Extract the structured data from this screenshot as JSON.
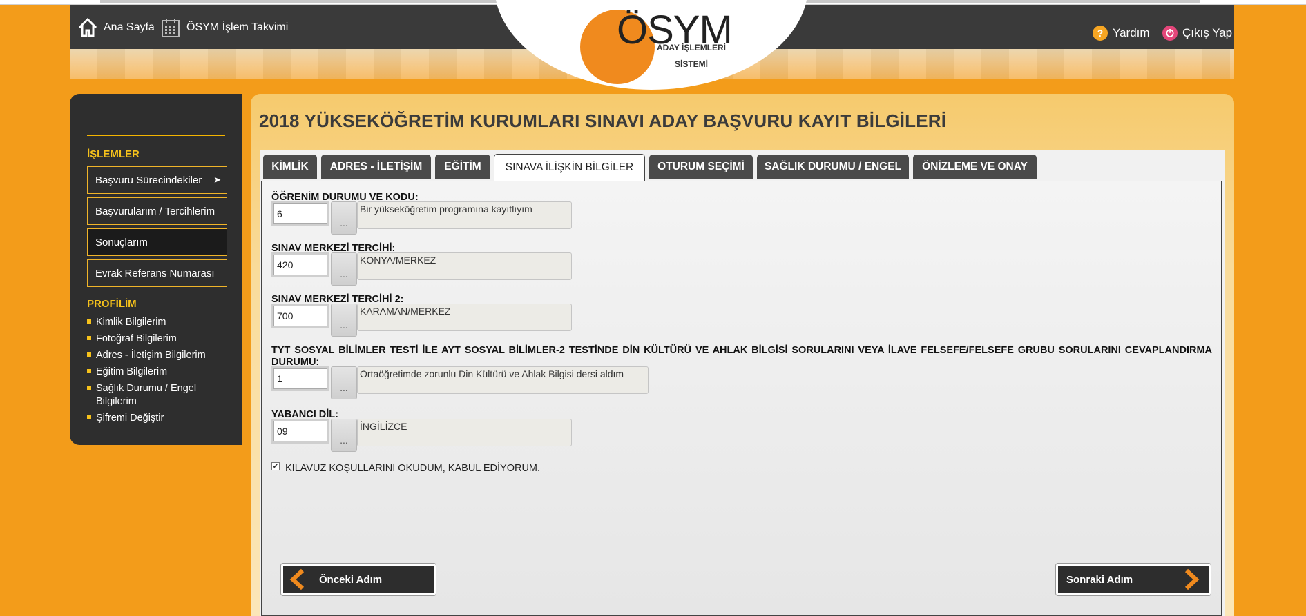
{
  "header": {
    "home_label": "Ana Sayfa",
    "calendar_label": "ÖSYM İşlem Takvimi",
    "help_label": "Yardım",
    "logout_label": "Çıkış Yap",
    "logo_text": "ÖSYM",
    "logo_sub1": "ADAY İŞLEMLERİ",
    "logo_sub2": "SİSTEMİ"
  },
  "sidebar": {
    "section_operations": "İŞLEMLER",
    "operations": [
      {
        "label": "Başvuru Sürecindekiler"
      },
      {
        "label": "Başvurularım / Tercihlerim"
      },
      {
        "label": "Sonuçlarım"
      },
      {
        "label": "Evrak Referans Numarası"
      }
    ],
    "section_profile": "PROFİLİM",
    "profile_items": [
      {
        "label": "Kimlik Bilgilerim"
      },
      {
        "label": "Fotoğraf Bilgilerim"
      },
      {
        "label": "Adres - İletişim Bilgilerim"
      },
      {
        "label": "Eğitim Bilgilerim"
      },
      {
        "label": "Sağlık Durumu / Engel Bilgilerim"
      },
      {
        "label": "Şifremi Değiştir"
      }
    ]
  },
  "main": {
    "title": "2018 YÜKSEKÖĞRETİM KURUMLARI SINAVI ADAY BAŞVURU KAYIT BİLGİLERİ",
    "tabs": [
      {
        "label": "KİMLİK"
      },
      {
        "label": "ADRES - İLETİŞİM"
      },
      {
        "label": "EĞİTİM"
      },
      {
        "label": "SINAVA İLİŞKİN BİLGİLER"
      },
      {
        "label": "OTURUM SEÇİMİ"
      },
      {
        "label": "SAĞLIK DURUMU / ENGEL"
      },
      {
        "label": "ÖNİZLEME VE ONAY"
      }
    ],
    "active_tab": "SINAVA İLİŞKİN BİLGİLER",
    "fields": [
      {
        "label": "ÖĞRENİM DURUMU VE KODU:",
        "code": "6",
        "description": "Bir yükseköğretim programına kayıtlıyım"
      },
      {
        "label": "SINAV MERKEZİ TERCİHİ:",
        "code": "420",
        "description": "KONYA/MERKEZ"
      },
      {
        "label": "SINAV MERKEZİ TERCİHİ 2:",
        "code": "700",
        "description": "KARAMAN/MERKEZ"
      },
      {
        "label": "TYT SOSYAL BİLİMLER TESTİ İLE AYT SOSYAL BİLİMLER-2 TESTİNDE DİN KÜLTÜRÜ VE AHLAK BİLGİSİ SORULARINI VEYA İLAVE FELSEFE/FELSEFE GRUBU SORULARINI CEVAPLANDIRMA DURUMU:",
        "code": "1",
        "description": "Ortaöğretimde zorunlu Din Kültürü ve Ahlak Bilgisi dersi aldım"
      },
      {
        "label": "YABANCI DİL:",
        "code": "09",
        "description": "İNGİLİZCE"
      }
    ],
    "lookup_label": "...",
    "agree_label": "KILAVUZ KOŞULLARINI OKUDUM, KABUL EDİYORUM.",
    "agree_checked": true,
    "prev_label": "Önceki Adım",
    "next_label": "Sonraki Adım"
  },
  "colors": {
    "background": "#f39c1a",
    "dark": "#2e2e2e",
    "accent_yellow": "#f6c21b",
    "logo_orange": "#f08a1e"
  }
}
